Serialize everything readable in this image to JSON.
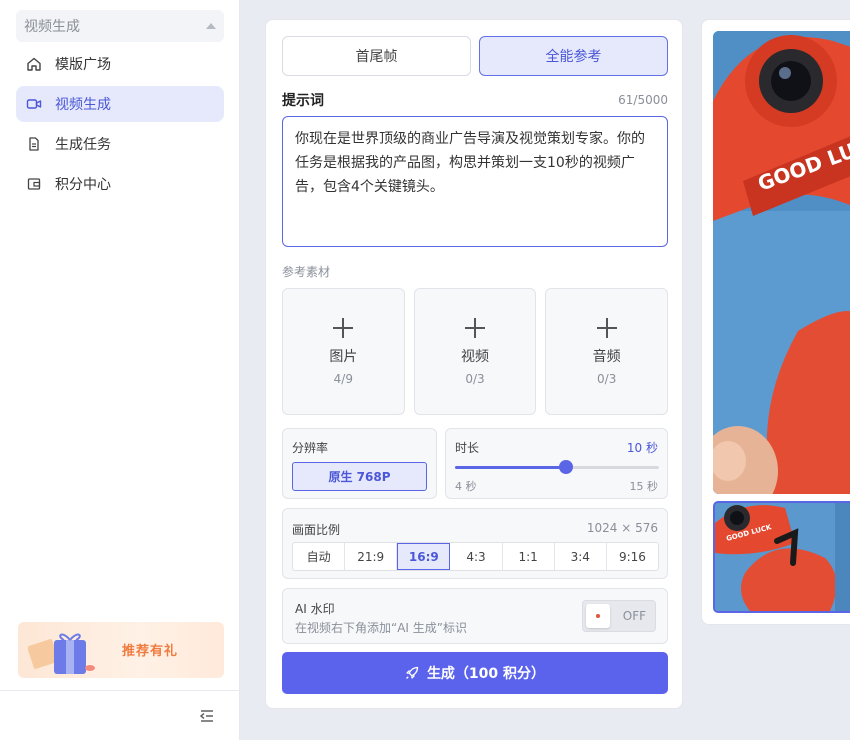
{
  "sidebar": {
    "section_title": "视频生成",
    "items": [
      {
        "label": "模版广场",
        "icon": "home-icon",
        "active": false
      },
      {
        "label": "视频生成",
        "icon": "video-camera-icon",
        "active": true
      },
      {
        "label": "生成任务",
        "icon": "document-icon",
        "active": false
      },
      {
        "label": "积分中心",
        "icon": "wallet-icon",
        "active": false
      }
    ],
    "promo_label": "推荐有礼"
  },
  "main": {
    "tabs": [
      {
        "label": "首尾帧",
        "active": false
      },
      {
        "label": "全能参考",
        "active": true
      }
    ],
    "prompt": {
      "label": "提示词",
      "counter": "61/5000",
      "value": "你现在是世界顶级的商业广告导演及视觉策划专家。你的任务是根据我的产品图，构思并策划一支10秒的视频广告，包含4个关键镜头。"
    },
    "reference": {
      "title": "参考素材",
      "cards": [
        {
          "label": "图片",
          "count": "4/9"
        },
        {
          "label": "视频",
          "count": "0/3"
        },
        {
          "label": "音频",
          "count": "0/3"
        }
      ]
    },
    "resolution": {
      "label": "分辨率",
      "value": "原生 768P"
    },
    "duration": {
      "label": "时长",
      "value_label": "10 秒",
      "min_label": "4 秒",
      "max_label": "15 秒",
      "value": 10,
      "min": 4,
      "max": 15
    },
    "aspect_ratio": {
      "label": "画面比例",
      "dimensions": "1024 × 576",
      "options": [
        "自动",
        "21:9",
        "16:9",
        "4:3",
        "1:1",
        "3:4",
        "9:16"
      ],
      "selected": "16:9"
    },
    "watermark": {
      "label": "AI 水印",
      "description": "在视频右下角添加“AI 生成”标识",
      "toggle_state": "OFF"
    },
    "generate_label": "生成（100 积分）"
  },
  "preview": {
    "main_caption": "GOOD LUCK",
    "thumb_caption": "GOOD LUCK"
  },
  "colors": {
    "accent": "#5b63ec",
    "accent_light": "#e5e9fb",
    "background": "#e9ebf2"
  }
}
